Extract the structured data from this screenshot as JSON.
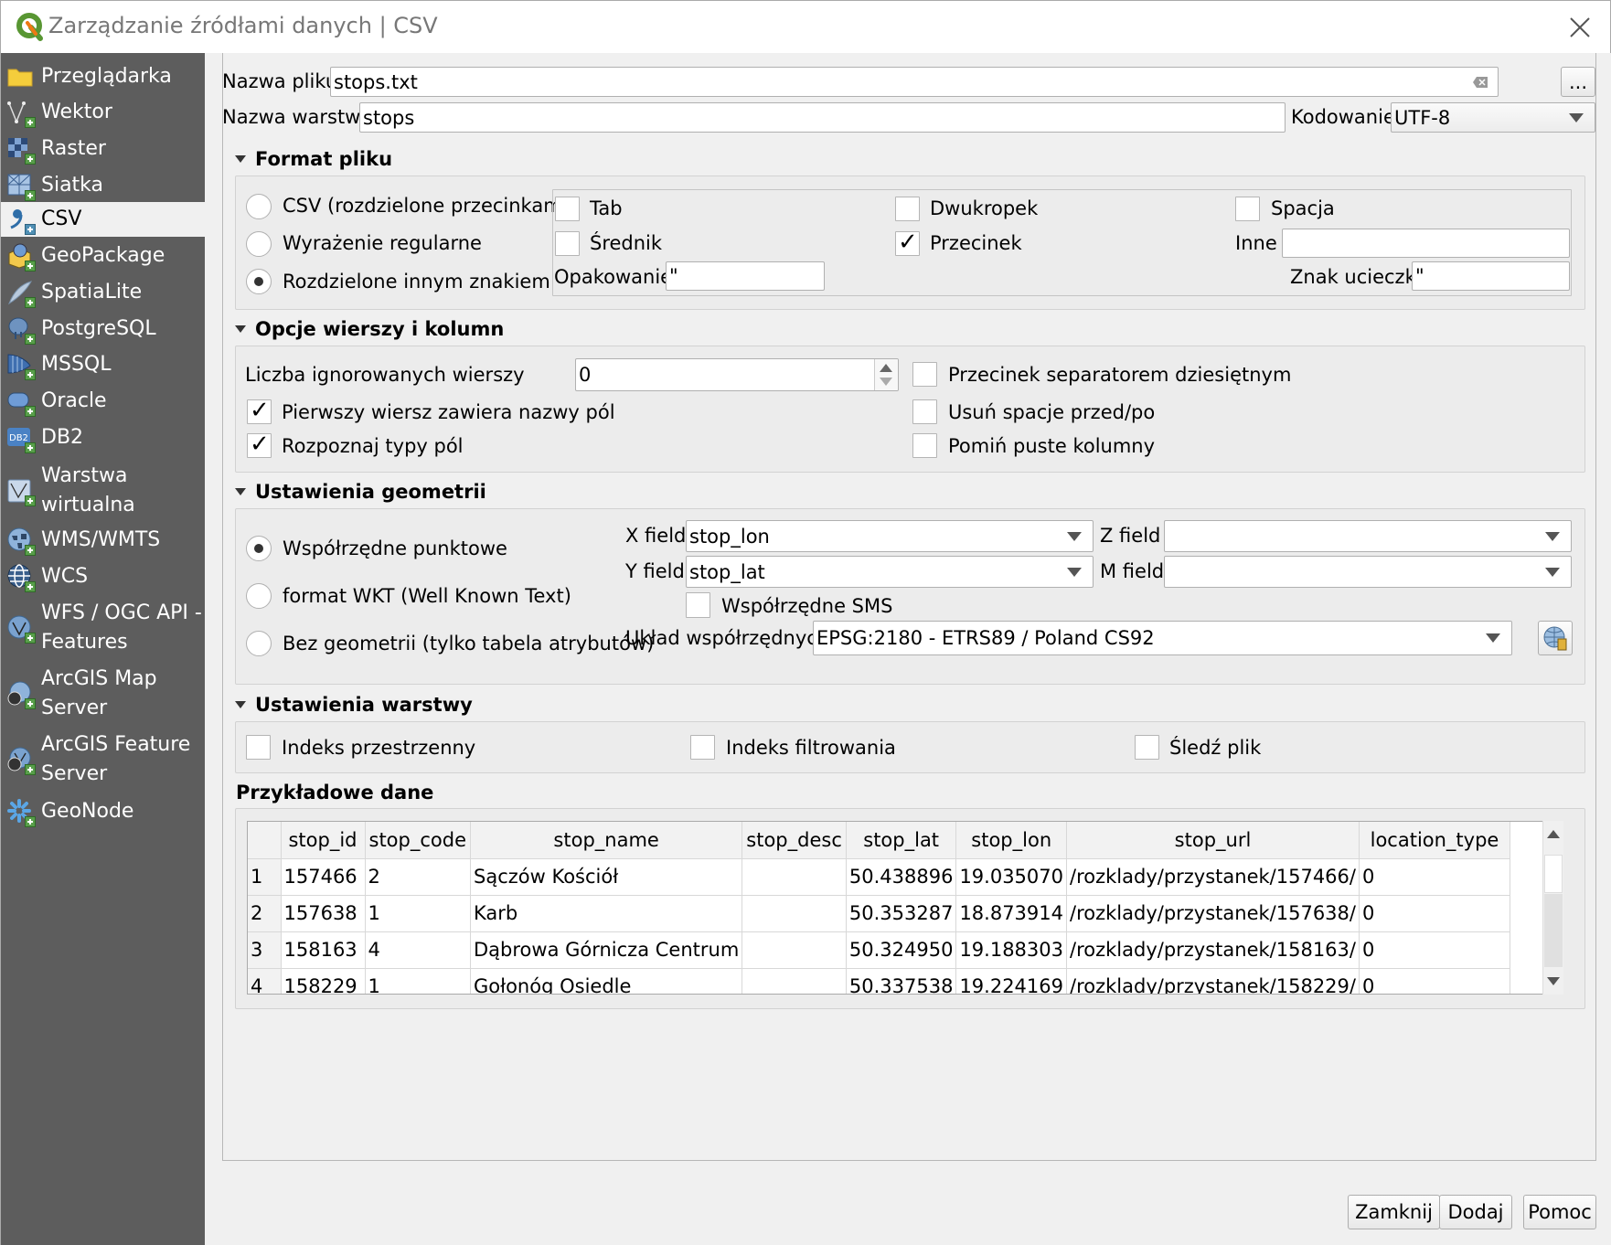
{
  "window": {
    "title": "Zarządzanie źródłami danych | CSV",
    "close_icon": "close-icon"
  },
  "sidebar": {
    "items": [
      {
        "label": "Przeglądarka",
        "icon": "folder-icon"
      },
      {
        "label": "Wektor",
        "icon": "vector-icon"
      },
      {
        "label": "Raster",
        "icon": "raster-icon"
      },
      {
        "label": "Siatka",
        "icon": "mesh-icon"
      },
      {
        "label": "CSV",
        "icon": "csv-icon",
        "active": true
      },
      {
        "label": "GeoPackage",
        "icon": "geopackage-icon"
      },
      {
        "label": "SpatiaLite",
        "icon": "spatialite-icon"
      },
      {
        "label": "PostgreSQL",
        "icon": "postgresql-icon"
      },
      {
        "label": "MSSQL",
        "icon": "mssql-icon"
      },
      {
        "label": "Oracle",
        "icon": "oracle-icon"
      },
      {
        "label": "DB2",
        "icon": "db2-icon"
      },
      {
        "label": "Warstwa wirtualna",
        "icon": "virtual-layer-icon"
      },
      {
        "label": "WMS/WMTS",
        "icon": "wms-icon"
      },
      {
        "label": "WCS",
        "icon": "wcs-icon"
      },
      {
        "label": "WFS / OGC API - Features",
        "icon": "wfs-icon"
      },
      {
        "label": "ArcGIS Map Server",
        "icon": "arcgis-map-icon"
      },
      {
        "label": "ArcGIS Feature Server",
        "icon": "arcgis-feature-icon"
      },
      {
        "label": "GeoNode",
        "icon": "geonode-icon"
      }
    ]
  },
  "file": {
    "filename_label": "Nazwa pliku",
    "filename_value": "stops.txt",
    "browse_label": "...",
    "layer_name_label": "Nazwa warstwy",
    "layer_name_value": "stops",
    "encoding_label": "Kodowanie",
    "encoding_value": "UTF-8"
  },
  "file_format": {
    "header": "Format pliku",
    "radios": [
      {
        "label": "CSV (rozdzielone przecinkami)",
        "checked": false
      },
      {
        "label": "Wyrażenie regularne",
        "checked": false
      },
      {
        "label": "Rozdzielone innym znakiem",
        "checked": true
      }
    ],
    "delimiters": {
      "tab": {
        "label": "Tab",
        "checked": false
      },
      "colon": {
        "label": "Dwukropek",
        "checked": false
      },
      "space": {
        "label": "Spacja",
        "checked": false
      },
      "semicolon": {
        "label": "Średnik",
        "checked": false
      },
      "comma": {
        "label": "Przecinek",
        "checked": true
      },
      "other_label": "Inne",
      "other_value": ""
    },
    "quote_label": "Opakowanie",
    "quote_value": "\"",
    "escape_label": "Znak ucieczki",
    "escape_value": "\""
  },
  "record_options": {
    "header": "Opcje wierszy i kolumn",
    "skip_lines_label": "Liczba ignorowanych wierszy",
    "skip_lines_value": "0",
    "first_record_header": {
      "label": "Pierwszy wiersz zawiera nazwy pól",
      "checked": true
    },
    "detect_field_types": {
      "label": "Rozpoznaj typy pól",
      "checked": true
    },
    "decimal_comma": {
      "label": "Przecinek separatorem dziesiętnym",
      "checked": false
    },
    "trim_fields": {
      "label": "Usuń spacje przed/po",
      "checked": false
    },
    "discard_empty": {
      "label": "Pomiń puste kolumny",
      "checked": false
    }
  },
  "geometry": {
    "header": "Ustawienia geometrii",
    "radios": [
      {
        "label": "Współrzędne punktowe",
        "checked": true
      },
      {
        "label": "format WKT (Well Known Text)",
        "checked": false
      },
      {
        "label": "Bez geometrii (tylko tabela atrybutów)",
        "checked": false
      }
    ],
    "x_field_label": "X field",
    "x_field_value": "stop_lon",
    "y_field_label": "Y field",
    "y_field_value": "stop_lat",
    "z_field_label": "Z field",
    "z_field_value": "",
    "m_field_label": "M field",
    "m_field_value": "",
    "dms": {
      "label": "Współrzędne SMS",
      "checked": false
    },
    "crs_label": "Układ współrzędnych",
    "crs_value": "EPSG:2180 - ETRS89 / Poland CS92",
    "crs_button_icon": "crs-selector-icon"
  },
  "layer_settings": {
    "header": "Ustawienia warstwy",
    "spatial_index": {
      "label": "Indeks przestrzenny",
      "checked": false
    },
    "subset_index": {
      "label": "Indeks filtrowania",
      "checked": false
    },
    "watch_file": {
      "label": "Śledź plik",
      "checked": false
    }
  },
  "sample": {
    "header": "Przykładowe dane",
    "columns": [
      "",
      "stop_id",
      "stop_code",
      "stop_name",
      "stop_desc",
      "stop_lat",
      "stop_lon",
      "stop_url",
      "location_type"
    ],
    "rows": [
      [
        "1",
        "157466",
        "2",
        "Sączów Kościół",
        "",
        "50.438896",
        "19.035070",
        "/rozklady/przystanek/157466/",
        "0"
      ],
      [
        "2",
        "157638",
        "1",
        "Karb",
        "",
        "50.353287",
        "18.873914",
        "/rozklady/przystanek/157638/",
        "0"
      ],
      [
        "3",
        "158163",
        "4",
        "Dąbrowa Górnicza Centrum",
        "",
        "50.324950",
        "19.188303",
        "/rozklady/przystanek/158163/",
        "0"
      ],
      [
        "4",
        "158229",
        "1",
        "Gołonóg Osiedle",
        "",
        "50.337538",
        "19.224169",
        "/rozklady/przystanek/158229/",
        "0"
      ]
    ]
  },
  "buttons": {
    "close": "Zamknij",
    "add": "Dodaj",
    "help": "Pomoc"
  }
}
